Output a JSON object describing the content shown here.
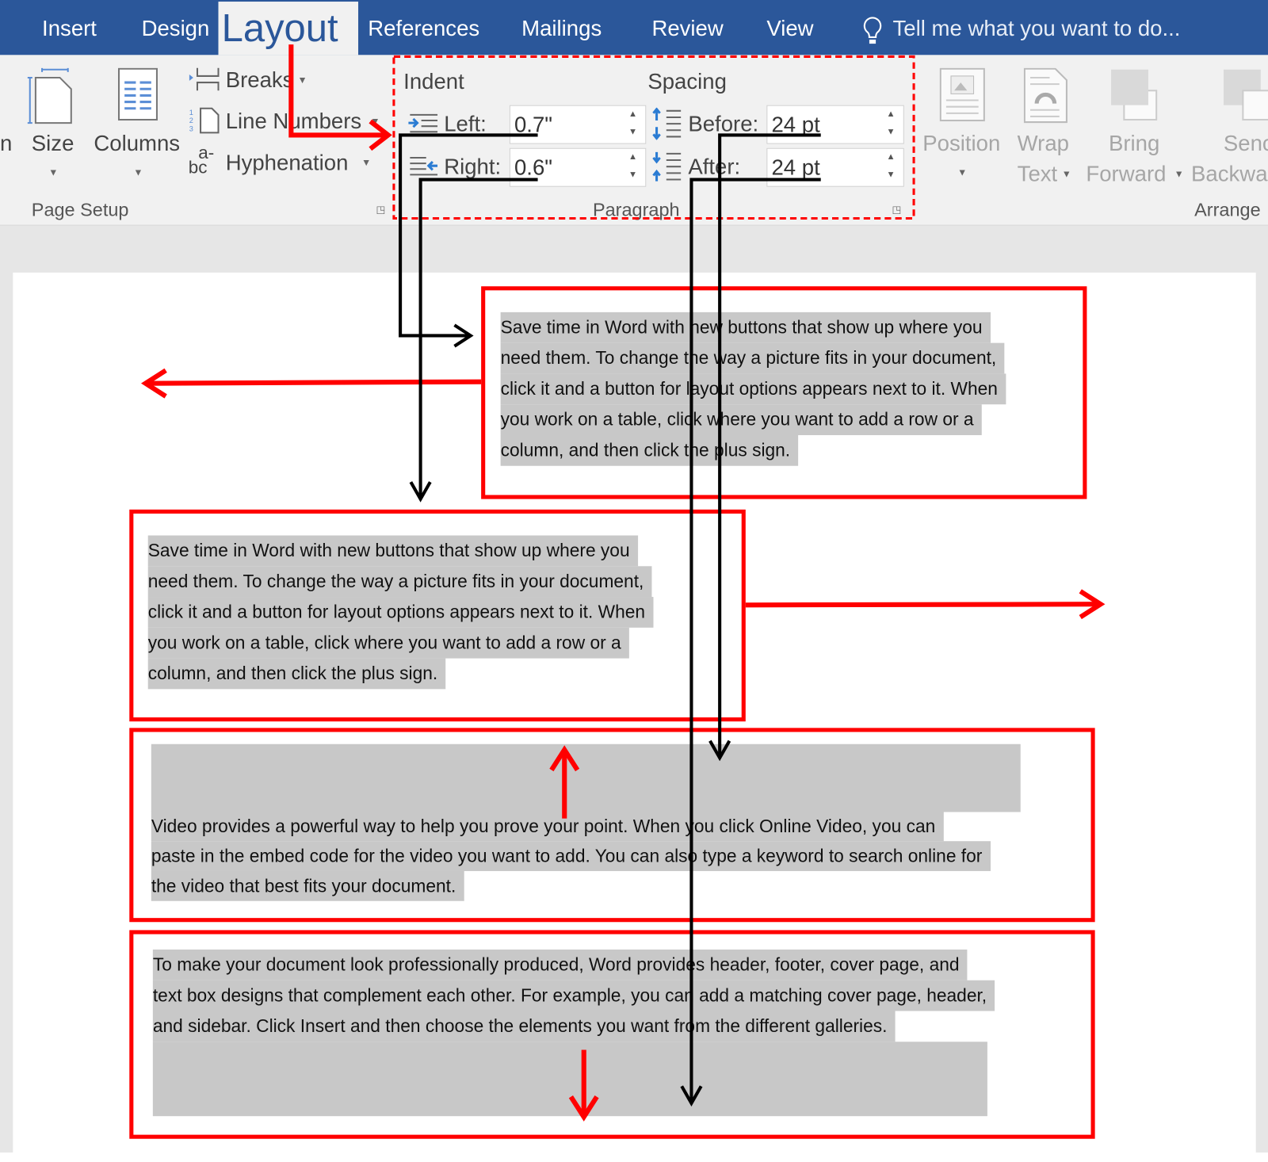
{
  "tabs": {
    "insert": "Insert",
    "design": "Design",
    "layout": "Layout",
    "references": "References",
    "mailings": "Mailings",
    "review": "Review",
    "view": "View",
    "tell_me": "Tell me what you want to do..."
  },
  "page_setup": {
    "cut_label": "n",
    "size": "Size",
    "columns": "Columns",
    "breaks": "Breaks",
    "line_numbers": "Line Numbers",
    "hyphenation": "Hyphenation",
    "group_label": "Page Setup"
  },
  "paragraph": {
    "indent_label": "Indent",
    "left_label": "Left:",
    "left_value": "0.7\"",
    "right_label": "Right:",
    "right_value": "0.6\"",
    "spacing_label": "Spacing",
    "before_label": "Before:",
    "before_value": "24 pt",
    "after_label": "After:",
    "after_value": "24 pt",
    "group_label": "Paragraph"
  },
  "arrange": {
    "position": "Position",
    "wrap": "Wrap",
    "wrap2": "Text",
    "bring": "Bring",
    "bring2": "Forward",
    "send": "Senc",
    "send2": "Backwa",
    "group_label": "Arrange"
  },
  "colors": {
    "accent": "#2b579a",
    "annotation_red": "#ff0000",
    "highlight": "#c8c8c8"
  },
  "document": {
    "para1": [
      "Save time in Word with new buttons that show up where you",
      "need them. To change the way a picture fits in your document,",
      "click it and a button for layout options appears next to it. When",
      "you work on a table, click where you want to add a row or a",
      "column, and then click the plus sign."
    ],
    "para2": [
      "Save time in Word with new buttons that show up where you",
      "need them. To change the way a picture fits in your document,",
      "click it and a button for layout options appears next to it. When",
      "you work on a table, click where you want to add a row or a",
      "column, and then click the plus sign."
    ],
    "para3": [
      "Video provides a powerful way to help you prove your point. When you click Online Video, you can",
      "paste in the embed code for the video you want to add. You can also type a keyword to search online for",
      "the video that best fits your document."
    ],
    "para4": [
      "To make your document look professionally produced, Word provides header, footer, cover page, and",
      "text box designs that complement each other. For example, you can add a matching cover page, header,",
      "and sidebar. Click Insert and then choose the elements you want from the different galleries."
    ]
  }
}
